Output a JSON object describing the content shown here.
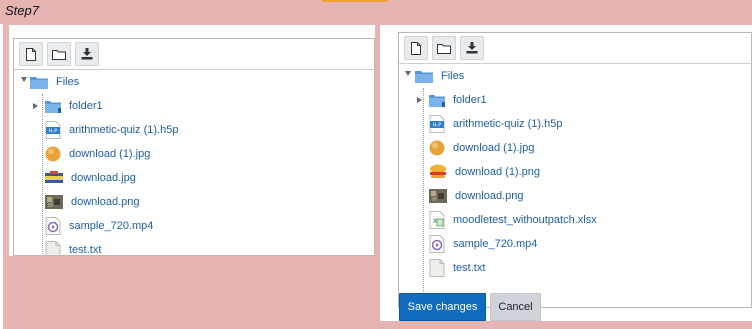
{
  "step_label": "Step7",
  "toolbar": {
    "add_file_icon": "add-file-icon",
    "create_folder_icon": "create-folder-icon",
    "download_icon": "download-icon"
  },
  "left_panel": {
    "root": "Files",
    "items": [
      {
        "label": "folder1",
        "icon": "folder-icon"
      },
      {
        "label": "arithmetic-quiz (1).h5p",
        "icon": "h5p-file-icon"
      },
      {
        "label": "download (1).jpg",
        "icon": "orange-image-icon"
      },
      {
        "label": "download.jpg",
        "icon": "image-thumbnail-icon"
      },
      {
        "label": "download.png",
        "icon": "image-thumbnail-icon"
      },
      {
        "label": "sample_720.mp4",
        "icon": "video-file-icon"
      },
      {
        "label": "test.txt",
        "icon": "text-file-icon"
      }
    ]
  },
  "right_panel": {
    "root": "Files",
    "items": [
      {
        "label": "folder1",
        "icon": "folder-icon"
      },
      {
        "label": "arithmetic-quiz (1).h5p",
        "icon": "h5p-file-icon"
      },
      {
        "label": "download (1).jpg",
        "icon": "orange-image-icon"
      },
      {
        "label": "download (1).png",
        "icon": "burger-image-icon"
      },
      {
        "label": "download.png",
        "icon": "image-thumbnail-icon"
      },
      {
        "label": "moodletest_withoutpatch.xlsx",
        "icon": "spreadsheet-file-icon"
      },
      {
        "label": "sample_720.mp4",
        "icon": "video-file-icon"
      },
      {
        "label": "test.txt",
        "icon": "text-file-icon"
      }
    ]
  },
  "buttons": {
    "save": "Save changes",
    "cancel": "Cancel"
  },
  "colors": {
    "background": "#e6b4b3",
    "link": "#1f5fa8",
    "primary_button": "#0f6cbf",
    "secondary_button": "#ced4da"
  }
}
